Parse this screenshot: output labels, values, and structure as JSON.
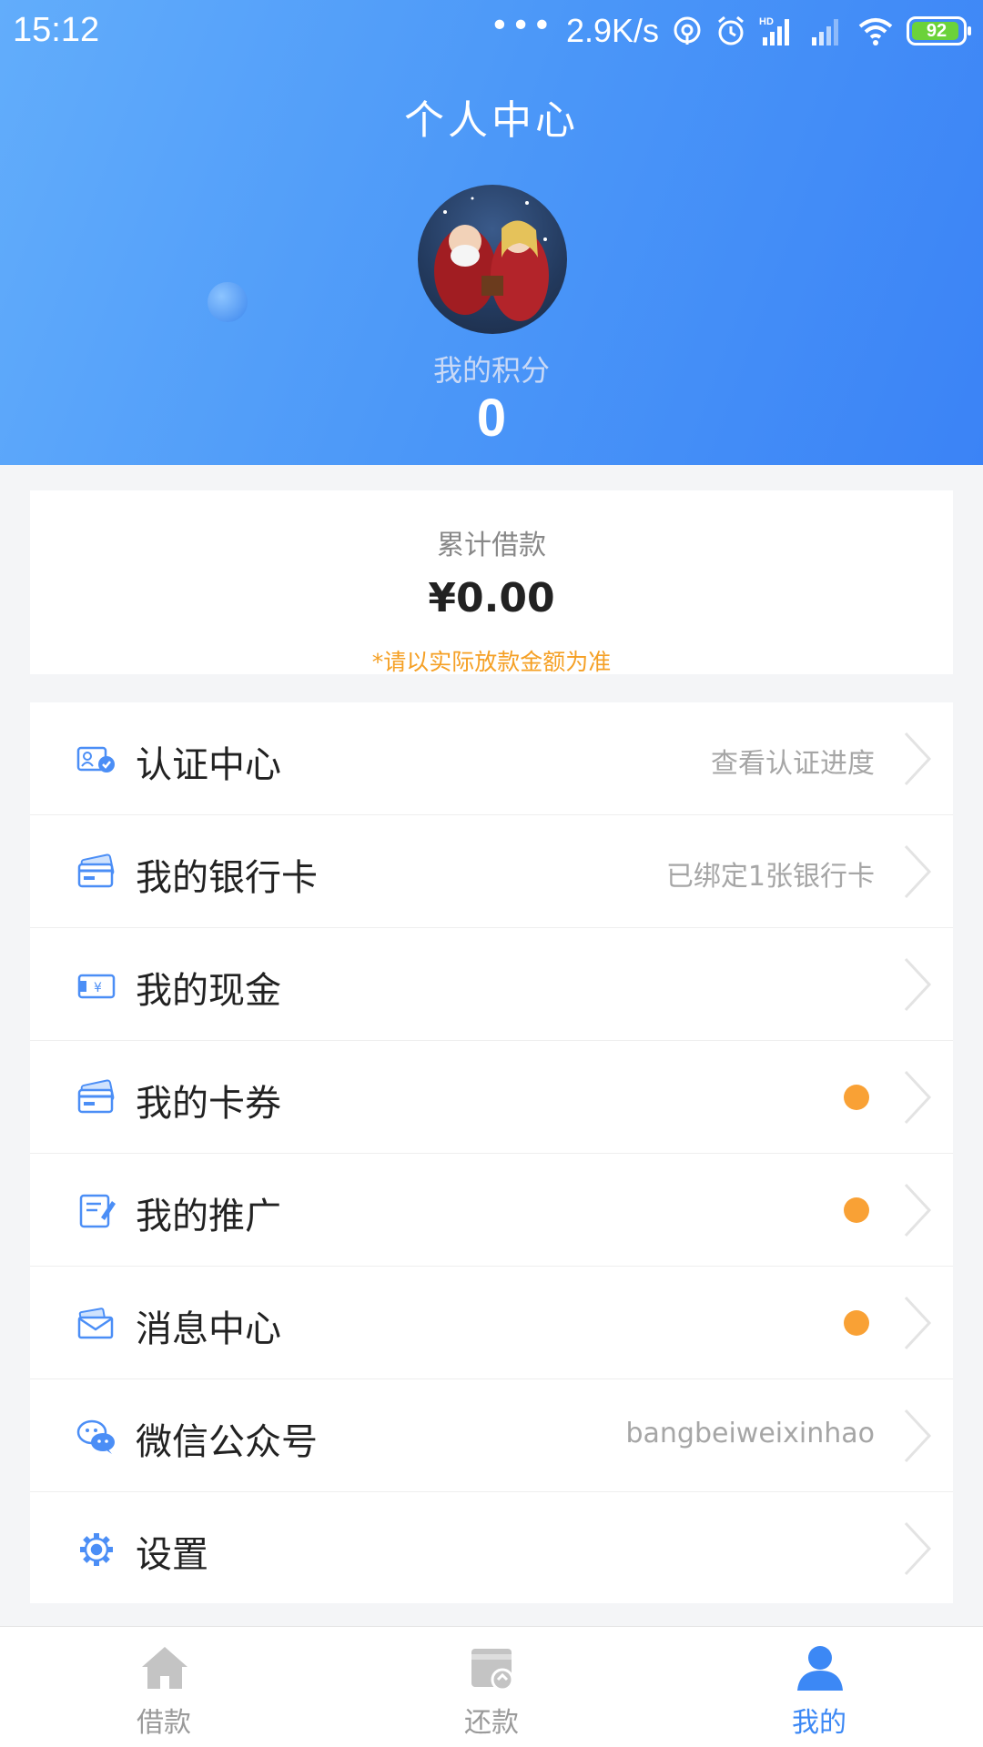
{
  "status_bar": {
    "time": "15:12",
    "dots": "•••",
    "net_speed": "2.9K/s",
    "battery": "92"
  },
  "header": {
    "title": "个人中心",
    "points_label": "我的积分",
    "points_value": "0"
  },
  "loan_summary": {
    "label": "累计借款",
    "amount": "¥0.00",
    "note": "*请以实际放款金额为准"
  },
  "menu": {
    "items": [
      {
        "label": "认证中心",
        "value": "查看认证进度",
        "icon": "verify-badge-icon"
      },
      {
        "label": "我的银行卡",
        "value": "已绑定1张银行卡",
        "icon": "bank-card-icon"
      },
      {
        "label": "我的现金",
        "value": "",
        "icon": "cash-icon"
      },
      {
        "label": "我的卡券",
        "value": "",
        "icon": "coupon-icon",
        "badge": true
      },
      {
        "label": "我的推广",
        "value": "",
        "icon": "promotion-icon",
        "badge": true
      },
      {
        "label": "消息中心",
        "value": "",
        "icon": "message-icon",
        "badge": true
      },
      {
        "label": "微信公众号",
        "value": "bangbeiweixinhao",
        "icon": "wechat-icon"
      },
      {
        "label": "设置",
        "value": "",
        "icon": "settings-gear-icon"
      }
    ]
  },
  "tabbar": {
    "tabs": [
      {
        "label": "借款",
        "icon": "home-icon",
        "active": false
      },
      {
        "label": "还款",
        "icon": "repay-icon",
        "active": false
      },
      {
        "label": "我的",
        "icon": "user-icon",
        "active": true
      }
    ]
  },
  "colors": {
    "header_gradient_start": "#62adfb",
    "header_gradient_end": "#3b83f6",
    "accent": "#3c88f5",
    "badge_orange": "#f9a135",
    "note_orange": "#f5a025"
  }
}
